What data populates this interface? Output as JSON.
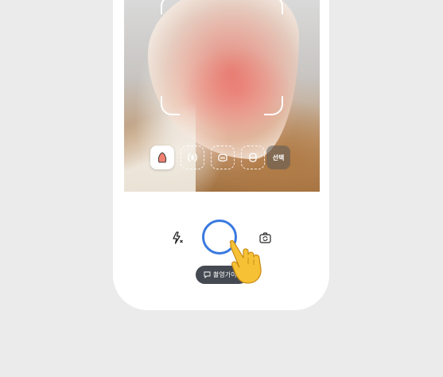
{
  "capture_screen": {
    "part_chips": [
      {
        "id": "ear",
        "icon": "ear-icon",
        "selected": true
      },
      {
        "id": "eye",
        "icon": "eye-icon",
        "selected": false
      },
      {
        "id": "teeth",
        "icon": "teeth-icon",
        "selected": false
      },
      {
        "id": "belly",
        "icon": "body-icon",
        "selected": false
      }
    ],
    "select_chip_label": "선택",
    "flash_icon": "flash-off-icon",
    "switch_camera_icon": "camera-switch-icon",
    "shutter_icon": "shutter-button",
    "guide_pill_label": "촬영가이드",
    "guide_pill_icon": "guide-chat-icon",
    "pointer_icon": "pointing-hand-icon"
  },
  "colors": {
    "background": "#ebebeb",
    "shutter_ring": "#3a79e0",
    "pill_bg": "#454a52"
  }
}
